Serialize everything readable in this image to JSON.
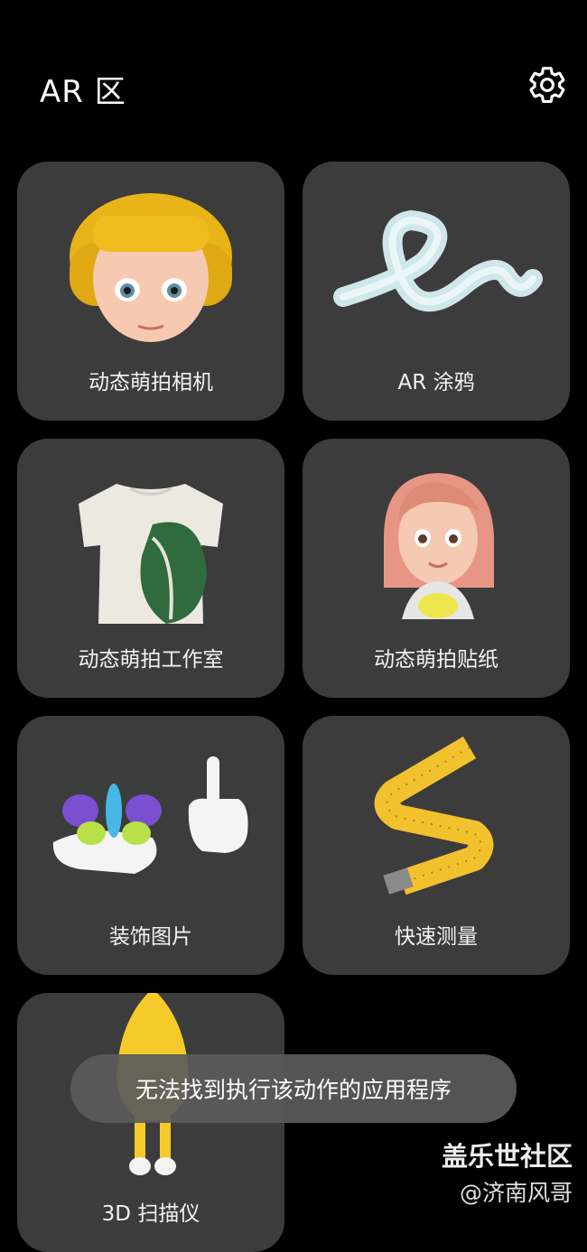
{
  "header": {
    "title": "AR 区",
    "settings_icon": "gear-icon"
  },
  "tiles": [
    {
      "label": "动态萌拍相机",
      "icon": "avatar-girl-bob-icon"
    },
    {
      "label": "AR 涂鸦",
      "icon": "doodle-squiggle-icon"
    },
    {
      "label": "动态萌拍工作室",
      "icon": "tshirt-icon"
    },
    {
      "label": "动态萌拍贴纸",
      "icon": "avatar-woman-icon"
    },
    {
      "label": "装饰图片",
      "icon": "balloon-hand-icon"
    },
    {
      "label": "快速测量",
      "icon": "measuring-tape-icon"
    },
    {
      "label": "3D 扫描仪",
      "icon": "banana-figure-icon"
    }
  ],
  "toast": {
    "message": "无法找到执行该动作的应用程序"
  },
  "watermark": {
    "site": "盖乐世社区",
    "author": "@济南风哥"
  },
  "colors": {
    "background": "#000000",
    "tile": "#3c3c3c",
    "toast": "#5a5a5a"
  }
}
